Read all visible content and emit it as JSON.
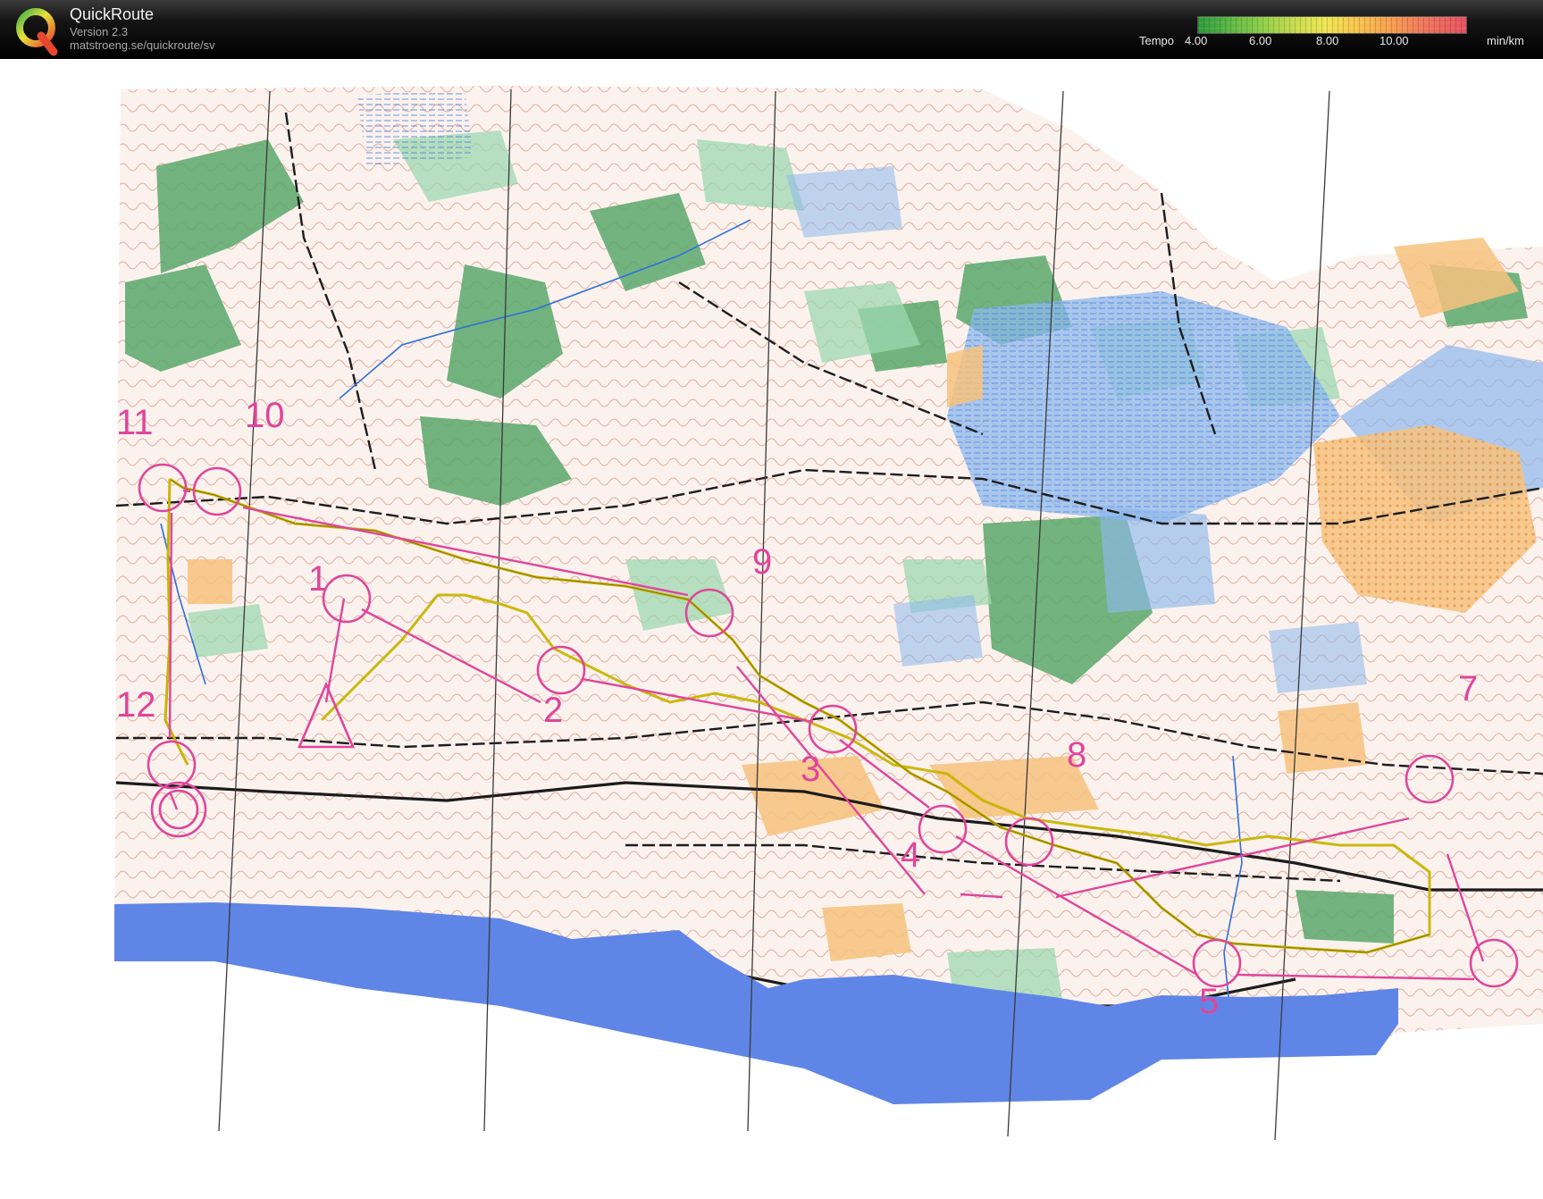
{
  "app": {
    "name": "QuickRoute",
    "version": "Version 2.3",
    "url": "matstroeng.se/quickroute/sv",
    "logo_icon": "quickroute-q-logo"
  },
  "tempo_legend": {
    "label": "Tempo",
    "ticks": [
      "4.00",
      "6.00",
      "8.00",
      "10.00"
    ],
    "unit": "min/km",
    "colors": [
      "#2e9a3c",
      "#8fcf48",
      "#f1e552",
      "#f79e4f",
      "#e8505f"
    ]
  },
  "map": {
    "course_color": "#e0459b",
    "route_color": "#c8b400",
    "sea_color": "#5f86e6",
    "controls": [
      "1",
      "2",
      "3",
      "4",
      "5",
      "7",
      "8",
      "9",
      "10",
      "11",
      "12"
    ]
  }
}
